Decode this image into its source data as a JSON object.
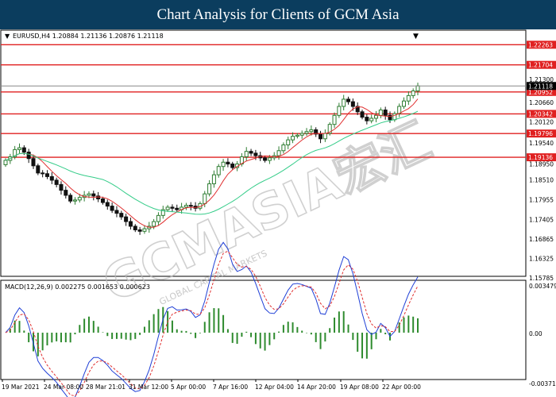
{
  "header": {
    "title": "Chart Analysis for Clients of GCM Asia"
  },
  "main_chart": {
    "symbol_label": "EURUSD,H4  1.20884 1.21136 1.20876 1.21118",
    "price_labels": [
      "1.21300",
      "1.20660",
      "1.20120",
      "1.19540",
      "1.18950",
      "1.18510",
      "1.17955",
      "1.17405",
      "1.16865",
      "1.16325",
      "1.15785"
    ],
    "current_price": "1.21118",
    "levels": [
      {
        "value": 1.22263,
        "label": "1.22263"
      },
      {
        "value": 1.21704,
        "label": "1.21704"
      },
      {
        "value": 1.20952,
        "label": "1.20952"
      },
      {
        "value": 1.20342,
        "label": "1.20342"
      },
      {
        "value": 1.19796,
        "label": "1.19796"
      },
      {
        "value": 1.19136,
        "label": "1.19136"
      }
    ]
  },
  "macd": {
    "label": "MACD(12,26,9) 0.002275 0.001653 0.000623",
    "axis_labels": [
      "0.003479",
      "0.00",
      "-0.003714"
    ]
  },
  "time_labels": [
    "19 Mar 2021",
    "24 Mar 08:00",
    "28 Mar 21:01",
    "31 Mar 12:00",
    "5 Apr 00:00",
    "7 Apr 16:00",
    "12 Apr 04:00",
    "14 Apr 20:00",
    "19 Apr 08:00",
    "22 Apr 00:00"
  ],
  "watermark": {
    "text": "GCMASIA宏汇",
    "subtext": "GLOBAL CAPITAL MARKETS"
  },
  "colors": {
    "header_bg": "#0b3d5e",
    "bull_candle": "#2e7d32",
    "bear_candle": "#111111",
    "level_line": "#e02020",
    "ma_fast": "#e03030",
    "ma_slow": "#33cc88",
    "macd_line": "#1f3fd6",
    "signal_line": "#e03030",
    "histogram": "#2e8b2e"
  },
  "chart_data": {
    "type": "candlestick",
    "closes": [
      1.1905,
      1.1915,
      1.1935,
      1.194,
      1.1928,
      1.191,
      1.189,
      1.187,
      1.1868,
      1.186,
      1.185,
      1.1838,
      1.1822,
      1.1808,
      1.1792,
      1.1795,
      1.1802,
      1.1808,
      1.1812,
      1.1806,
      1.1798,
      1.1788,
      1.1778,
      1.1766,
      1.1758,
      1.1748,
      1.1735,
      1.1722,
      1.1712,
      1.1708,
      1.1715,
      1.1722,
      1.1735,
      1.1752,
      1.1768,
      1.1775,
      1.1772,
      1.1768,
      1.1775,
      1.178,
      1.1778,
      1.1772,
      1.1785,
      1.1812,
      1.184,
      1.1865,
      1.1888,
      1.19,
      1.1895,
      1.1885,
      1.1895,
      1.1915,
      1.193,
      1.1925,
      1.1918,
      1.1912,
      1.1905,
      1.1912,
      1.1918,
      1.1932,
      1.1948,
      1.1962,
      1.1972,
      1.1975,
      1.198,
      1.1985,
      1.199,
      1.1978,
      1.1965,
      1.198,
      1.2005,
      1.203,
      1.2055,
      1.2075,
      1.2068,
      1.2055,
      1.204,
      1.2025,
      1.2015,
      1.2022,
      1.203,
      1.2045,
      1.203,
      1.2018,
      1.2035,
      1.2055,
      1.207,
      1.2085,
      1.2098,
      1.2112
    ]
  }
}
